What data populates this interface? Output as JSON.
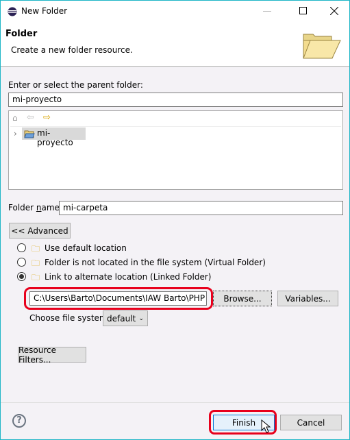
{
  "window": {
    "title": "New Folder"
  },
  "header": {
    "title": "Folder",
    "subtitle": "Create a new folder resource."
  },
  "parent": {
    "label": "Enter or select the parent folder:",
    "value": "mi-proyecto",
    "tree_item": "mi-proyecto"
  },
  "folder_name": {
    "label": "Folder name:",
    "value": "mi-carpeta"
  },
  "advanced": {
    "button": "<< Advanced",
    "options": [
      {
        "label": "Use default location",
        "selected": false
      },
      {
        "label": "Folder is not located in the file system (Virtual Folder)",
        "selected": false
      },
      {
        "label": "Link to alternate location (Linked Folder)",
        "selected": true
      }
    ],
    "location": "C:\\Users\\Barto\\Documents\\IAW Barto\\PHP",
    "browse": "Browse...",
    "variables": "Variables...",
    "fs_label": "Choose file system:",
    "fs_value": "default"
  },
  "resource_filters": "Resource Filters...",
  "footer": {
    "finish": "Finish",
    "cancel": "Cancel"
  },
  "colors": {
    "highlight": "#e8001c",
    "border": "#1cb5c6"
  }
}
